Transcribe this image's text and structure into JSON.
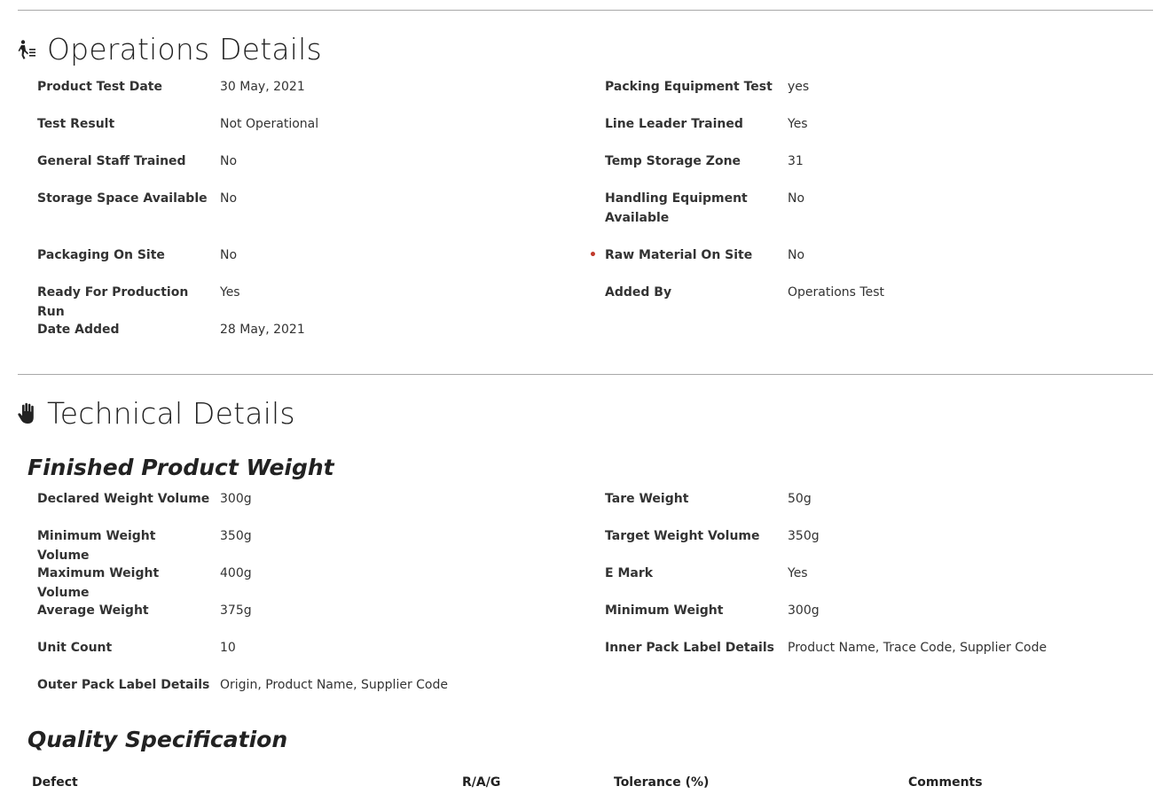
{
  "operations": {
    "title": "Operations Details",
    "icon": "person-cart-icon",
    "fields": [
      {
        "label": "Product Test Date",
        "value": "30 May, 2021"
      },
      {
        "label": "Packing Equipment Test",
        "value": "yes"
      },
      {
        "label": "Test Result",
        "value": "Not Operational"
      },
      {
        "label": "Line Leader Trained",
        "value": "Yes"
      },
      {
        "label": "General Staff Trained",
        "value": "No"
      },
      {
        "label": "Temp Storage Zone",
        "value": "31"
      },
      {
        "label": "Storage Space Available",
        "value": "No"
      },
      {
        "label": "Handling Equipment Available",
        "value": "No"
      },
      {
        "label": "Packaging On Site",
        "value": "No"
      },
      {
        "label": "Raw Material On Site",
        "value": "No",
        "required_marker": "•"
      },
      {
        "label": "Ready For Production Run",
        "value": "Yes"
      },
      {
        "label": "Added By",
        "value": "Operations Test"
      },
      {
        "label": "Date Added",
        "value": "28 May, 2021"
      }
    ]
  },
  "technical": {
    "title": "Technical Details",
    "icon": "hand-icon",
    "finished_product_weight": {
      "title": "Finished Product Weight",
      "fields": [
        {
          "label": "Declared Weight Volume",
          "value": "300g"
        },
        {
          "label": "Tare Weight",
          "value": "50g"
        },
        {
          "label": "Minimum Weight Volume",
          "value": "350g"
        },
        {
          "label": "Target Weight Volume",
          "value": "350g"
        },
        {
          "label": "Maximum Weight Volume",
          "value": "400g"
        },
        {
          "label": "E Mark",
          "value": "Yes"
        },
        {
          "label": "Average Weight",
          "value": "375g"
        },
        {
          "label": "Minimum Weight",
          "value": "300g"
        },
        {
          "label": "Unit Count",
          "value": "10"
        },
        {
          "label": "Inner Pack Label Details",
          "value": "Product Name, Trace Code, Supplier Code"
        },
        {
          "label": "Outer Pack Label Details",
          "value": "Origin, Product Name, Supplier Code"
        }
      ]
    },
    "quality_specification": {
      "title": "Quality Specification",
      "columns": [
        "Defect",
        "R/A/G",
        "Tolerance (%)",
        "Comments"
      ]
    }
  },
  "colors": {
    "divider": "#a8a8a8",
    "required": "#c0392b",
    "text": "#222222"
  }
}
